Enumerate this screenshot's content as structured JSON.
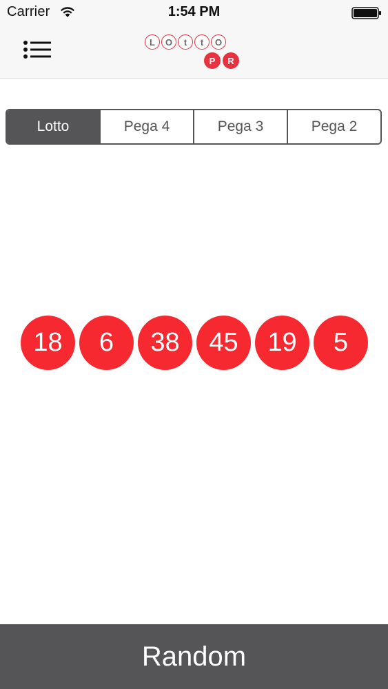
{
  "status_bar": {
    "carrier": "Carrier",
    "time": "1:54 PM",
    "wifi_icon": "wifi-icon",
    "battery_icon": "battery-icon"
  },
  "nav": {
    "menu_icon": "list-icon",
    "logo": {
      "top_letters": [
        "L",
        "O",
        "t",
        "t",
        "O"
      ],
      "bottom_letters": [
        "P",
        "R"
      ]
    }
  },
  "segments": {
    "items": [
      {
        "label": "Lotto",
        "selected": true
      },
      {
        "label": "Pega 4",
        "selected": false
      },
      {
        "label": "Pega 3",
        "selected": false
      },
      {
        "label": "Pega 2",
        "selected": false
      }
    ]
  },
  "balls": [
    "18",
    "6",
    "38",
    "45",
    "19",
    "5"
  ],
  "random_button": {
    "label": "Random"
  },
  "colors": {
    "ball": "#f5292f",
    "dark": "#555457",
    "logo_red": "#e6333f"
  }
}
